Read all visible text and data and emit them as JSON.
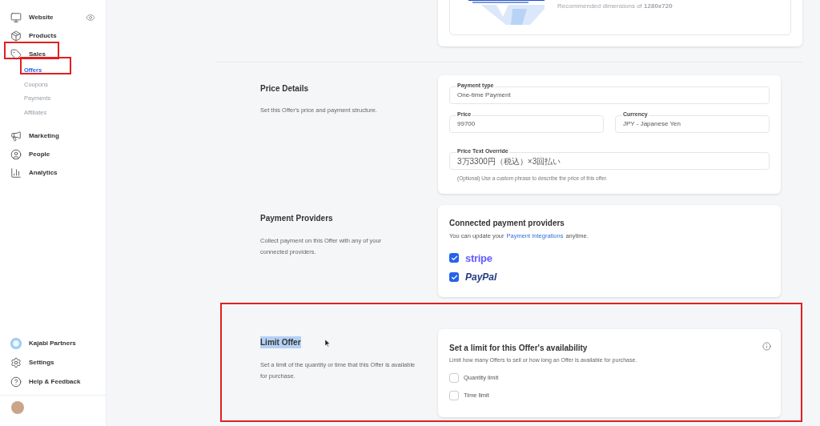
{
  "sidebar": {
    "items": [
      {
        "label": "Website",
        "selected": false
      },
      {
        "label": "Products",
        "selected": false
      },
      {
        "label": "Sales",
        "selected": false,
        "children": [
          {
            "label": "Offers",
            "selected": true
          },
          {
            "label": "Coupons",
            "selected": false
          },
          {
            "label": "Payments",
            "selected": false
          },
          {
            "label": "Affiliates",
            "selected": false
          }
        ]
      },
      {
        "label": "Marketing",
        "selected": false
      },
      {
        "label": "People",
        "selected": false
      },
      {
        "label": "Analytics",
        "selected": false
      }
    ],
    "bottom_items": [
      {
        "label": "Kajabi Partners"
      },
      {
        "label": "Settings"
      },
      {
        "label": "Help & Feedback"
      }
    ]
  },
  "image_card": {
    "hint": "Recommended dimensions of **1280x720**"
  },
  "price_details": {
    "title": "Price Details",
    "description": "Set this Offer's price and payment structure.",
    "fields": [
      {
        "label": "Payment type",
        "value": "One-time Payment"
      },
      {
        "label": "Price",
        "value": "99700"
      },
      {
        "label": "Currency",
        "value": "JPY - Japanese Yen"
      },
      {
        "label": "Price Text Override",
        "value": "3万3300円（税込）×3回払い"
      }
    ],
    "help": "(Optional) Use a custom phrase to describe the price of this offer."
  },
  "payment_providers": {
    "title": "Payment Providers",
    "description": "Collect payment on this Offer with any of your connected providers.",
    "card_title": "Connected payment providers",
    "card_text_before": "You can update your",
    "card_link": "Payment Integrations",
    "card_text_after": "anytime.",
    "providers": [
      {
        "label": "stripe",
        "kind": "stripe",
        "checked": true
      },
      {
        "label": "PayPal",
        "kind": "paypal",
        "checked": true
      }
    ]
  },
  "limit_offer": {
    "title": "Limit Offer",
    "title_highlighted": true,
    "description": "Set a limit of the quantity or time that this Offer is available for purchase.",
    "card_title": "Set a limit for this Offer's availability",
    "card_text": "Limit how many Offers to sell or how long an Offer is available for purchase.",
    "options": [
      {
        "label": "Quantity limit",
        "checked": false
      },
      {
        "label": "Time limit",
        "checked": false
      }
    ]
  }
}
